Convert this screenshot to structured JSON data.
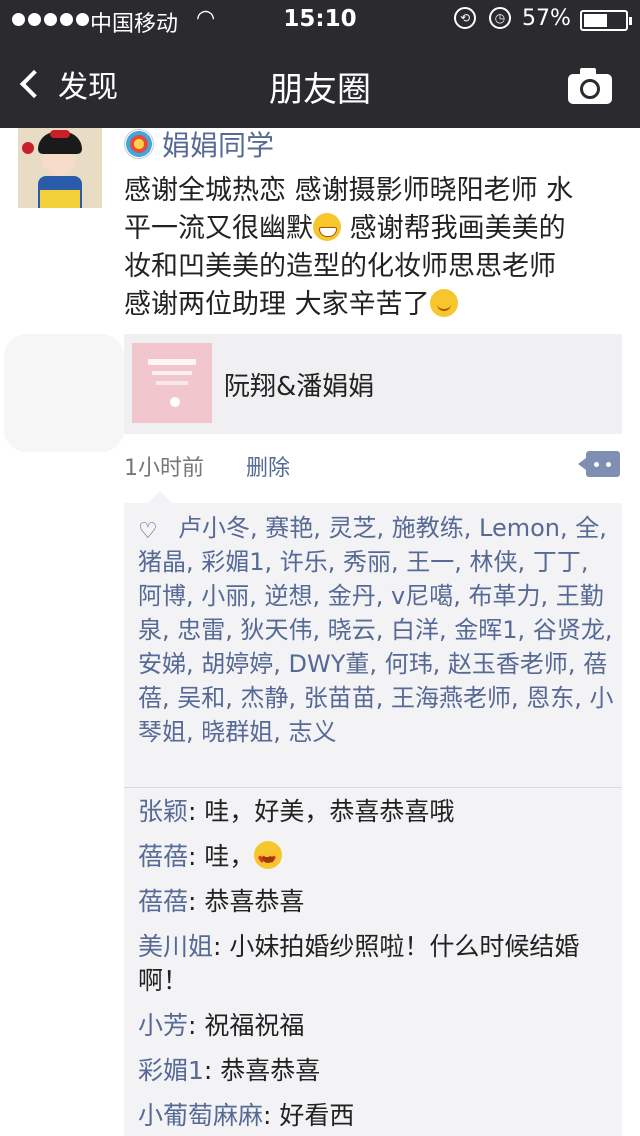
{
  "status_bar": {
    "carrier": "中国移动",
    "time": "15:10",
    "battery": "57%",
    "battery_level": 0.57
  },
  "nav": {
    "back_label": "发现",
    "title": "朋友圈"
  },
  "post": {
    "username": "娟娟同学",
    "text_lines": [
      "感谢全城热恋 感谢摄影师晓阳老师 水",
      "平一流又很幽默",
      " 感谢帮我画美美的",
      "妆和凹美美的造型的化妆师思思老师",
      "感谢两位助理 大家辛苦了"
    ],
    "link_title": "阮翔&潘娟娟",
    "time_ago": "1小时前",
    "delete_label": "删除"
  },
  "likes_text": "卢小冬, 赛艳, 灵芝, 施教练, Lemon, 全, 猪晶, 彩媚1, 许乐, 秀丽, 王一, 林侠, 丁丁, 阿博, 小丽, 逆想, 金丹, v尼噶, 布革力, 王勤泉, 忠雷, 狄天伟, 晓云, 白洋, 金晖1, 谷贤龙, 安娣, 胡婷婷, DWY董, 何玮, 赵玉香老师, 蓓蓓, 吴和, 杰静, 张苗苗, 王海燕老师, 恩东, 小琴姐, 晓群姐, 志义",
  "comments": [
    {
      "name": "张颖",
      "text": ": 哇，好美，恭喜恭喜哦"
    },
    {
      "name": "蓓蓓",
      "text": ": 哇，"
    },
    {
      "name": "蓓蓓",
      "text": ": 恭喜恭喜"
    },
    {
      "name": "美川姐",
      "text": ": 小妹拍婚纱照啦！什么时候结婚啊！"
    },
    {
      "name": "小芳",
      "text": ": 祝福祝福"
    },
    {
      "name": "彩媚1",
      "text": ": 恭喜恭喜"
    },
    {
      "name": "小葡萄麻麻",
      "text": ": 好看西"
    }
  ],
  "colors": {
    "nav_background": "#2b2b2f",
    "link_blue": "#566a95",
    "panel_background": "#f3f3f5"
  }
}
